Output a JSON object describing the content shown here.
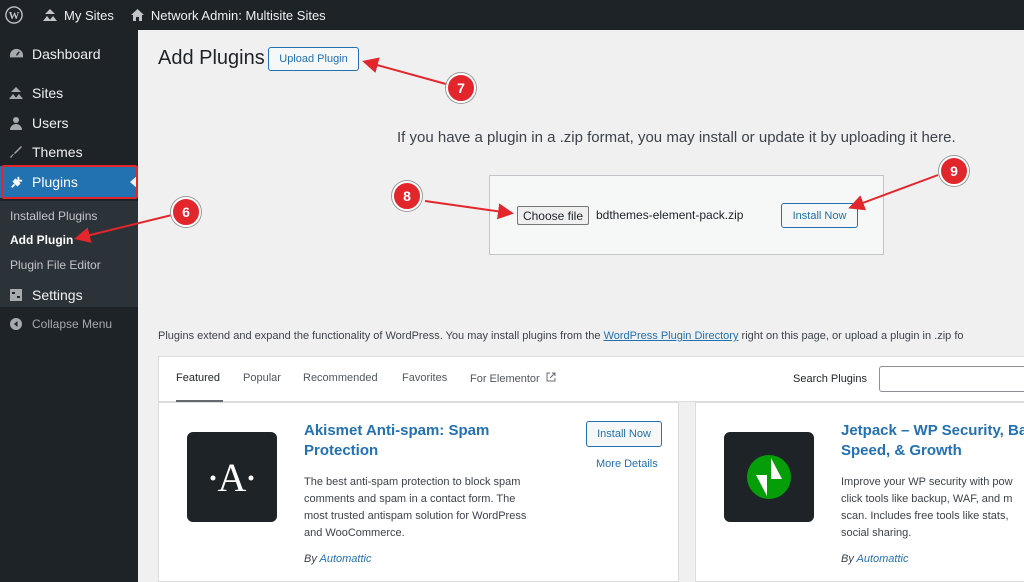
{
  "admin_bar": {
    "my_sites": "My Sites",
    "network_admin": "Network Admin: Multisite Sites"
  },
  "sidebar": {
    "items": [
      {
        "label": "Dashboard",
        "icon": "dashboard-icon"
      },
      {
        "label": "Sites",
        "icon": "sites-icon"
      },
      {
        "label": "Users",
        "icon": "users-icon"
      },
      {
        "label": "Themes",
        "icon": "themes-icon"
      },
      {
        "label": "Plugins",
        "icon": "plugins-icon"
      },
      {
        "label": "Settings",
        "icon": "settings-icon"
      }
    ],
    "submenu": [
      "Installed Plugins",
      "Add Plugin",
      "Plugin File Editor"
    ],
    "collapse_label": "Collapse Menu"
  },
  "page": {
    "title": "Add Plugins",
    "upload_button": "Upload Plugin",
    "upload_hint": "If you have a plugin in a .zip format, you may install or update it by uploading it here.",
    "choose_file": "Choose file",
    "file_name": "bdthemes-element-pack.zip",
    "install_now": "Install Now",
    "intro_before": "Plugins extend and expand the functionality of WordPress. You may install plugins from the ",
    "intro_link": "WordPress Plugin Directory",
    "intro_after": " right on this page, or upload a plugin in .zip fo"
  },
  "filter": {
    "tabs": [
      "Featured",
      "Popular",
      "Recommended",
      "Favorites",
      "For Elementor"
    ],
    "search_label": "Search Plugins"
  },
  "cards": [
    {
      "title_line1": "Akismet Anti-spam: Spam",
      "title_line2": "Protection",
      "desc": [
        "The best anti-spam protection to block spam",
        "comments and spam in a contact form. The",
        "most trusted antispam solution for WordPress",
        "and WooCommerce."
      ],
      "by": "By ",
      "author": "Automattic",
      "install": "Install Now",
      "more": "More Details"
    },
    {
      "title_line1": "Jetpack – WP Security, Ba",
      "title_line2": "Speed, & Growth",
      "desc": [
        "Improve your WP security with pow",
        "click tools like backup, WAF, and m",
        "scan. Includes free tools like stats,",
        "social sharing."
      ],
      "by": "By ",
      "author": "Automattic"
    }
  ],
  "annotations": [
    "6",
    "7",
    "8",
    "9"
  ],
  "colors": {
    "accent": "#2271b1",
    "annotation": "#e3262b",
    "admin_dark": "#1d2327"
  }
}
